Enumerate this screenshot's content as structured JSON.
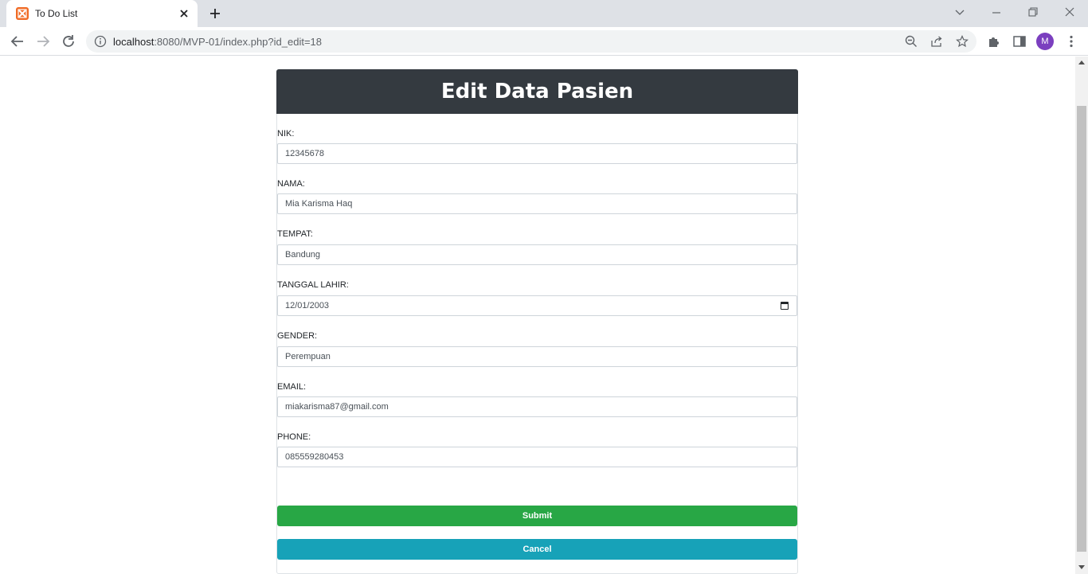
{
  "browser": {
    "tab_title": "To Do List",
    "url_host": "localhost",
    "url_rest": ":8080/MVP-01/index.php?id_edit=18",
    "avatar_letter": "M"
  },
  "page": {
    "title": "Edit Data Pasien",
    "fields": [
      {
        "label": "NIK:",
        "value": "12345678"
      },
      {
        "label": "NAMA:",
        "value": "Mia Karisma Haq"
      },
      {
        "label": "TEMPAT:",
        "value": "Bandung"
      },
      {
        "label": "TANGGAL LAHIR:",
        "value": "12/01/2003"
      },
      {
        "label": "GENDER:",
        "value": "Perempuan"
      },
      {
        "label": "EMAIL:",
        "value": "miakarisma87@gmail.com"
      },
      {
        "label": "PHONE:",
        "value": "085559280453"
      }
    ],
    "submit_label": "Submit",
    "cancel_label": "Cancel"
  },
  "colors": {
    "header": "#343a40",
    "submit": "#28a745",
    "cancel": "#17a2b8",
    "favicon": "#f06a24",
    "avatar": "#7b3fbf"
  },
  "icons": [
    "xampp-favicon-icon",
    "close-icon",
    "plus-icon",
    "chevron-down-icon",
    "minimize-icon",
    "restore-icon",
    "window-close-icon",
    "back-icon",
    "forward-icon",
    "reload-icon",
    "info-icon",
    "zoom-out-icon",
    "share-icon",
    "star-icon",
    "extensions-icon",
    "side-panel-icon",
    "menu-dots-icon",
    "calendar-icon"
  ]
}
